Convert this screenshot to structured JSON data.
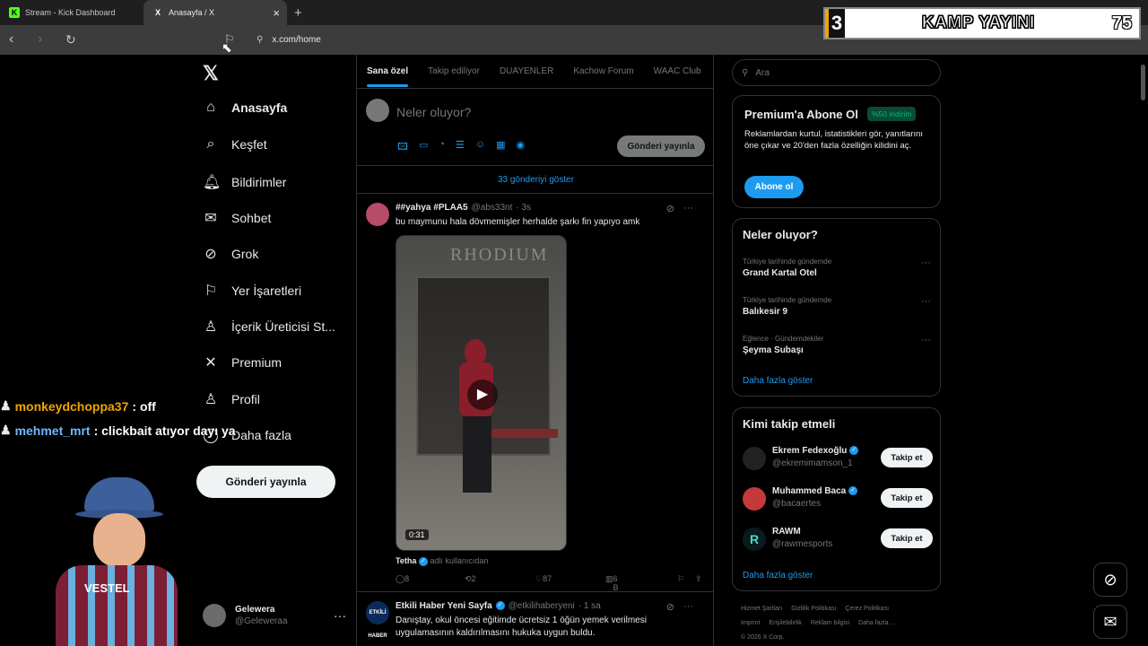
{
  "browser": {
    "tabs": [
      {
        "label": "Stream - Kick Dashboard",
        "favicon": "K",
        "active": false
      },
      {
        "label": "Anasayfa / X",
        "favicon": "X",
        "active": true
      }
    ],
    "new_tab_icon": "+",
    "url": "x.com/home"
  },
  "overlay": {
    "left_number": "3",
    "title": "KAMP YAYINI",
    "right_number": "75"
  },
  "leftnav": {
    "logo": "𝕏",
    "items": [
      {
        "label": "Anasayfa",
        "icon": "home-icon",
        "glyph": "⌂"
      },
      {
        "label": "Keşfet",
        "icon": "search-icon",
        "glyph": "⌕"
      },
      {
        "label": "Bildirimler",
        "icon": "bell-icon",
        "glyph": "🔔︎"
      },
      {
        "label": "Sohbet",
        "icon": "mail-icon",
        "glyph": "✉"
      },
      {
        "label": "Grok",
        "icon": "grok-icon",
        "glyph": "⊘"
      },
      {
        "label": "Yer İşaretleri",
        "icon": "bookmark-icon",
        "glyph": "⚐"
      },
      {
        "label": "İçerik Üreticisi St...",
        "icon": "creator-studio-icon",
        "glyph": "♙"
      },
      {
        "label": "Premium",
        "icon": "x-premium-icon",
        "glyph": "✕"
      },
      {
        "label": "Profil",
        "icon": "person-icon",
        "glyph": "♙"
      },
      {
        "label": "Daha fazla",
        "icon": "more-circle-icon",
        "glyph": "◯"
      }
    ],
    "post_button": "Gönderi yayınla",
    "profile": {
      "name": "Gelewera",
      "handle": "@Geleweraa",
      "more": "···"
    }
  },
  "feed": {
    "tabs": [
      "Sana özel",
      "Takip ediliyor",
      "DUAYENLER",
      "Kachow Forum",
      "WAAC Club"
    ],
    "composer_placeholder": "Neler oluyor?",
    "composer_icons": [
      "🖾",
      "▭",
      "◔",
      "☰",
      "☺",
      "▦",
      "◉"
    ],
    "composer_post": "Gönderi yayınla",
    "show_more": "33 gönderiyi göster",
    "tweet1": {
      "name": "##yahya #PLAA5",
      "handle": "@abs33nt",
      "time": "· 3s",
      "text": "bu maymunu hala dövmemişler herhalde şarkı fin yapıyo amk",
      "video_sign": "RHODIUM",
      "video_duration": "0:31",
      "credit_name": "Tetha",
      "credit_suffix": "adlı kullanıcıdan",
      "replies": "8",
      "reposts": "2",
      "likes": "87",
      "views": "6 B",
      "grok_icon": "⊘",
      "more": "···"
    },
    "tweet2": {
      "avatar_text": "ETKİLİ HABER",
      "name": "Etkili Haber Yeni Sayfa",
      "handle": "@etkilihaberyeni",
      "time": "· 1 sa",
      "text": "Danıştay, okul öncesi eğitimde ücretsiz 1 öğün yemek verilmesi uygulamasının kaldırılmasını hukuka uygun buldu."
    }
  },
  "right": {
    "search_placeholder": "Ara",
    "premium": {
      "title": "Premium'a Abone Ol",
      "badge": "%50 indirim",
      "text": "Reklamlardan kurtul, istatistikleri gör, yanıtlarını öne çıkar ve 20'den fazla özelliğin kilidini aç.",
      "button": "Abone ol"
    },
    "trends": {
      "title": "Neler oluyor?",
      "items": [
        {
          "category": "Türkiye tarihinde gündemde",
          "name": "Grand Kartal Otel"
        },
        {
          "category": "Türkiye tarihinde gündemde",
          "name": "Balıkesir 9"
        },
        {
          "category": "Eğlence · Gündemdekiler",
          "name": "Şeyma Subaşı"
        }
      ],
      "more": "Daha fazla göster"
    },
    "follow": {
      "title": "Kimi takip etmeli",
      "items": [
        {
          "name": "Ekrem Fedexoğlu",
          "handle": "@ekremimamson_1",
          "button": "Takip et",
          "verified": true,
          "color": "#222222"
        },
        {
          "name": "Muhammed Baca",
          "handle": "@bacaertes",
          "button": "Takip et",
          "verified": true,
          "color": "#c43a3a"
        },
        {
          "name": "RAWM",
          "handle": "@rawmesports",
          "button": "Takip et",
          "verified": false,
          "color": "#0b1a1f"
        }
      ],
      "more": "Daha fazla göster"
    },
    "footer": [
      "Hizmet Şartları",
      "Gizlilik Politikası",
      "Çerez Politikası",
      "Imprint",
      "Erişilebilirlik",
      "Reklam bilgisi",
      "Daha fazla ...",
      "© 2026 X Corp."
    ]
  },
  "chat": [
    {
      "user": "monkeydchoppa37",
      "message": ": off"
    },
    {
      "user": "mehmet_mrt",
      "message": ": clickbait atıyor dayı ya"
    }
  ],
  "streamer_shirt_text": "VESTEL",
  "floating": {
    "grok": "⊘",
    "messages": "✉"
  }
}
